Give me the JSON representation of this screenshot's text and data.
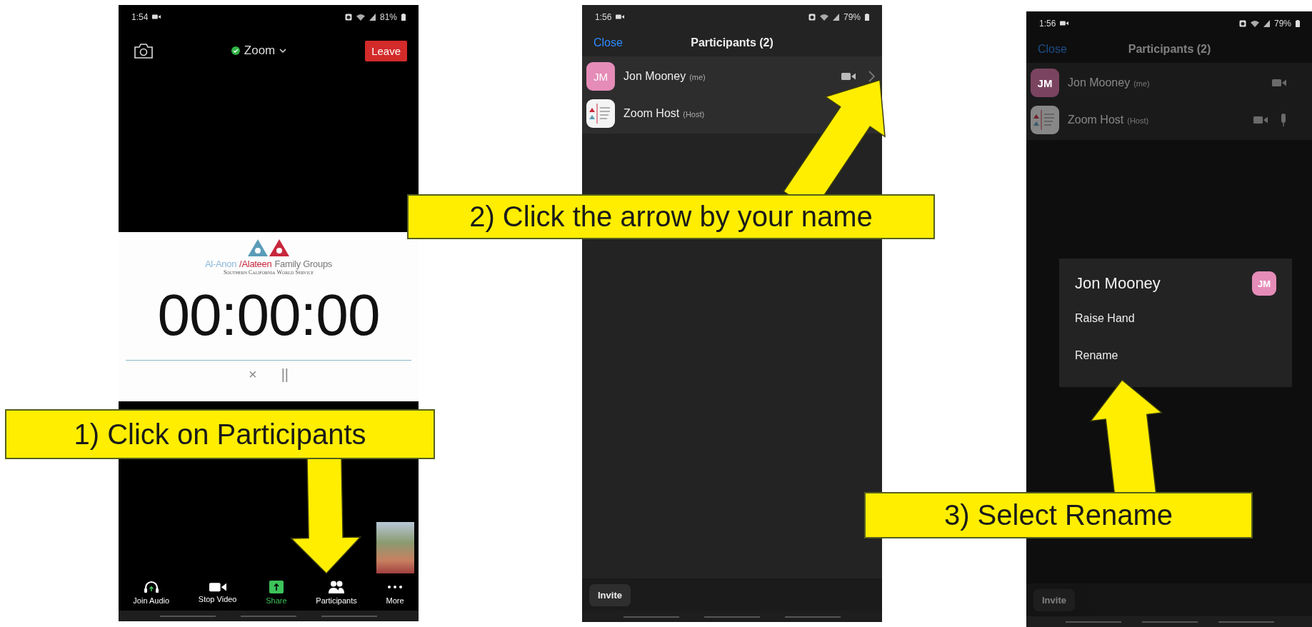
{
  "panels": [
    {
      "kind": "meeting",
      "status_bar": {
        "time": "1:54",
        "battery": "81%"
      },
      "meeting_title": "Zoom",
      "leave": "Leave",
      "shared_screen": {
        "title_parts": [
          {
            "text": "Al-Anon",
            "color": "#8ab8d8"
          },
          {
            "text": "/Alateen",
            "color": "#c8283c"
          },
          {
            "text": "Family Groups",
            "color": "#7a7a7a"
          }
        ],
        "subtitle": "Southern California World Service",
        "timer": "00:00:00",
        "close_glyph": "×",
        "pause_glyph": "||"
      },
      "toolbar": [
        {
          "kind": "headphones",
          "label": "Join Audio",
          "highlighted": false
        },
        {
          "kind": "video",
          "label": "Stop Video",
          "highlighted": false
        },
        {
          "kind": "share",
          "label": "Share",
          "highlighted": true
        },
        {
          "kind": "participants",
          "label": "Participants",
          "highlighted": false
        },
        {
          "kind": "more",
          "label": "More",
          "highlighted": false
        }
      ]
    },
    {
      "kind": "participants",
      "dimmed": false,
      "status_bar": {
        "time": "1:56",
        "battery": "79%"
      },
      "close": "Close",
      "title": "Participants (2)",
      "participants": [
        {
          "kind": "initials",
          "initials": "JM",
          "name": "Jon Mooney",
          "tag": "(me)",
          "video": true,
          "mic": false,
          "chevron": true
        },
        {
          "kind": "logo",
          "name": "Zoom Host",
          "tag": "(Host)"
        }
      ],
      "invite": "Invite"
    },
    {
      "kind": "participants",
      "dimmed": true,
      "status_bar": {
        "time": "1:56",
        "battery": "79%"
      },
      "close": "Close",
      "title": "Participants (2)",
      "participants": [
        {
          "kind": "initials",
          "initials": "JM",
          "name": "Jon Mooney",
          "tag": "(me)",
          "video": true,
          "mic": false,
          "chevron": false
        },
        {
          "kind": "logo",
          "name": "Zoom Host",
          "tag": "(Host)",
          "video": true,
          "mic": true,
          "chevron": false
        }
      ],
      "invite": "Invite",
      "menu": {
        "title": "Jon Mooney",
        "initials": "JM",
        "items": [
          "Raise Hand",
          "Rename"
        ]
      }
    }
  ],
  "callouts": [
    {
      "text": "1) Click on Participants"
    },
    {
      "text": "2) Click the arrow by your name"
    },
    {
      "text": "3) Select Rename"
    }
  ]
}
